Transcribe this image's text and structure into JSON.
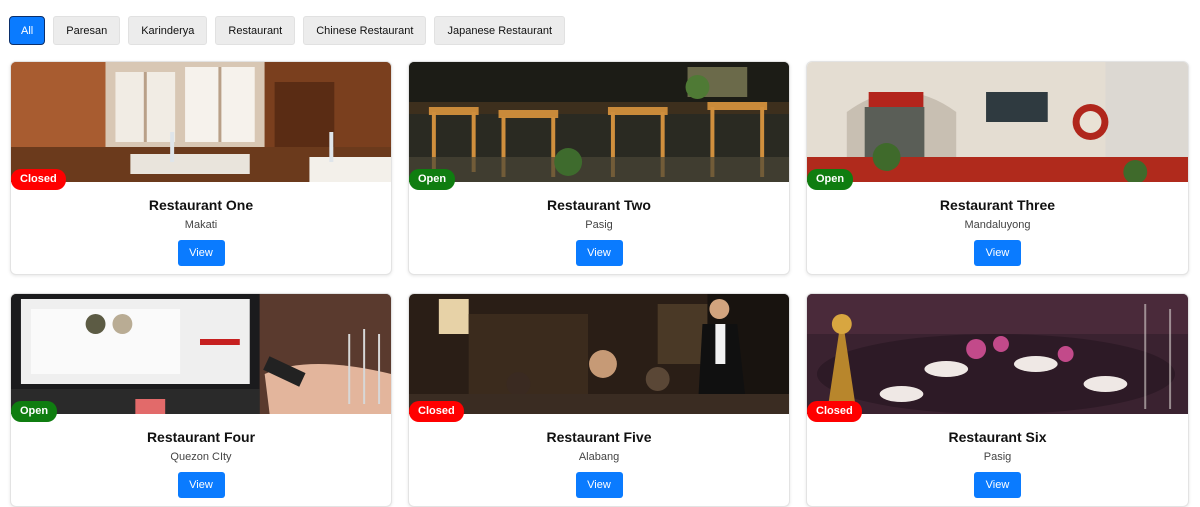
{
  "filters": [
    {
      "label": "All",
      "active": true
    },
    {
      "label": "Paresan",
      "active": false
    },
    {
      "label": "Karinderya",
      "active": false
    },
    {
      "label": "Restaurant",
      "active": false
    },
    {
      "label": "Chinese Restaurant",
      "active": false
    },
    {
      "label": "Japanese Restaurant",
      "active": false
    }
  ],
  "restaurants": [
    {
      "name": "Restaurant One",
      "location": "Makati",
      "status": "Closed",
      "view_label": "View"
    },
    {
      "name": "Restaurant Two",
      "location": "Pasig",
      "status": "Open",
      "view_label": "View"
    },
    {
      "name": "Restaurant Three",
      "location": "Mandaluyong",
      "status": "Open",
      "view_label": "View"
    },
    {
      "name": "Restaurant Four",
      "location": "Quezon CIty",
      "status": "Open",
      "view_label": "View"
    },
    {
      "name": "Restaurant Five",
      "location": "Alabang",
      "status": "Closed",
      "view_label": "View"
    },
    {
      "name": "Restaurant Six",
      "location": "Pasig",
      "status": "Closed",
      "view_label": "View"
    }
  ],
  "colors": {
    "primary": "#0a7bff",
    "closed": "#ff0000",
    "open": "#0f7d10"
  }
}
